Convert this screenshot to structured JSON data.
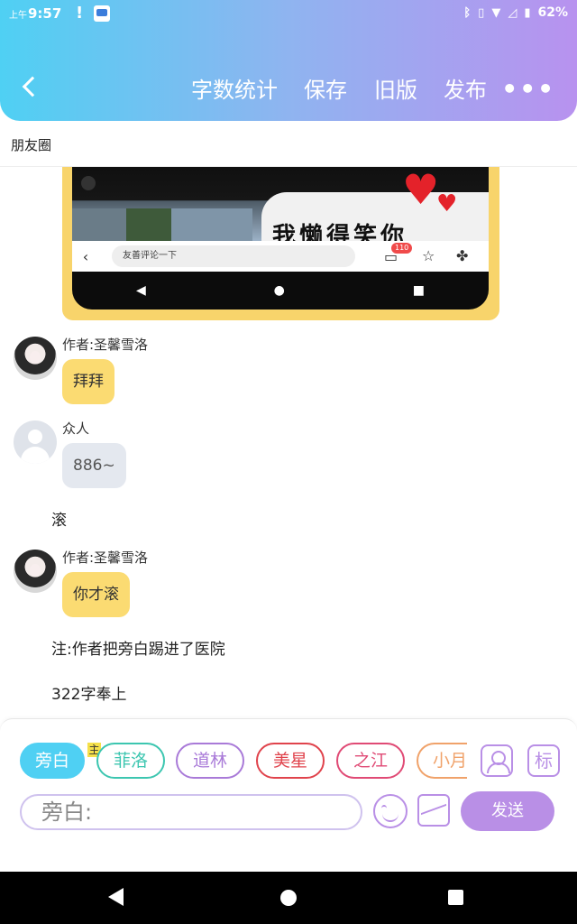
{
  "status_bar": {
    "ampm": "上午",
    "time": "9:57",
    "alert": "!",
    "battery": "62%"
  },
  "navbar": {
    "back_icon": "chevron-left-icon",
    "word_count": "字数统计",
    "save": "保存",
    "old_version": "旧版",
    "publish": "发布",
    "more": "•••"
  },
  "subtitle": "朋友圈",
  "embedded_image": {
    "caption_text": "我懒得笑你",
    "comment_placeholder": "友善评论一下",
    "comment_count": "110"
  },
  "messages": [
    {
      "type": "bubble",
      "speaker": "作者:圣馨雪洛",
      "avatar": "anime",
      "text": "拜拜"
    },
    {
      "type": "bubble",
      "speaker": "众人",
      "avatar": "default",
      "text": "886~"
    },
    {
      "type": "narration",
      "text": "滚"
    },
    {
      "type": "bubble",
      "speaker": "作者:圣馨雪洛",
      "avatar": "anime",
      "text": "你才滚"
    },
    {
      "type": "narration",
      "text": "注:作者把旁白踢进了医院"
    },
    {
      "type": "narration",
      "text": "322字奉上"
    }
  ],
  "characters": {
    "main_badge": "主",
    "list": [
      {
        "label": "旁白",
        "color": "#4fd0f3",
        "active": true
      },
      {
        "label": "菲洛",
        "color": "#3cc6b0",
        "active": false
      },
      {
        "label": "道林",
        "color": "#a97ad8",
        "active": false
      },
      {
        "label": "美星",
        "color": "#e0434c",
        "active": false
      },
      {
        "label": "之江",
        "color": "#e04a75",
        "active": false
      },
      {
        "label": "小月",
        "color": "#f0a26a",
        "active": false
      }
    ],
    "tag_button": "标"
  },
  "composer": {
    "placeholder": "旁白:",
    "send": "发送"
  }
}
